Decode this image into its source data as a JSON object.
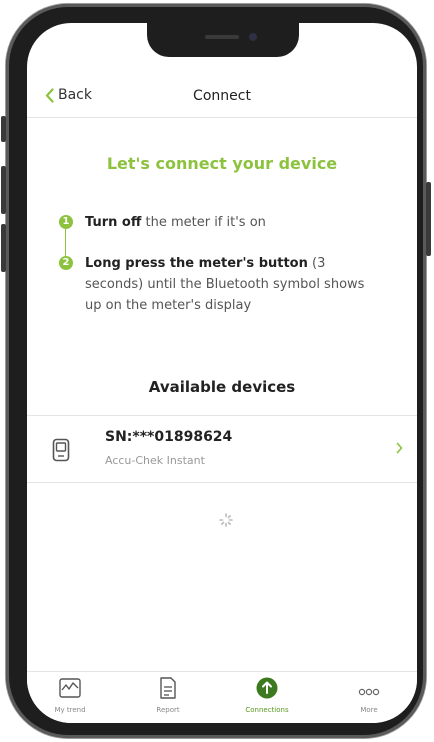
{
  "nav": {
    "back_label": "Back",
    "title": "Connect"
  },
  "headline": "Let's connect your device",
  "steps": [
    {
      "number": "1",
      "bold": "Turn off",
      "rest": " the meter if it's on"
    },
    {
      "number": "2",
      "bold": "Long press the meter's button",
      "rest": " (3 seconds) until the Bluetooth symbol shows up on the meter's display"
    }
  ],
  "available_title": "Available devices",
  "device": {
    "serial": "SN:***01898624",
    "name": "Accu-Chek Instant"
  },
  "tabs": [
    {
      "label": "My trend",
      "icon": "trend-icon"
    },
    {
      "label": "Report",
      "icon": "report-icon"
    },
    {
      "label": "Connections",
      "icon": "connections-icon",
      "active": true
    },
    {
      "label": "More",
      "icon": "more-icon"
    }
  ],
  "colors": {
    "accent": "#8dc23f",
    "text": "#222222",
    "muted": "#999999"
  }
}
